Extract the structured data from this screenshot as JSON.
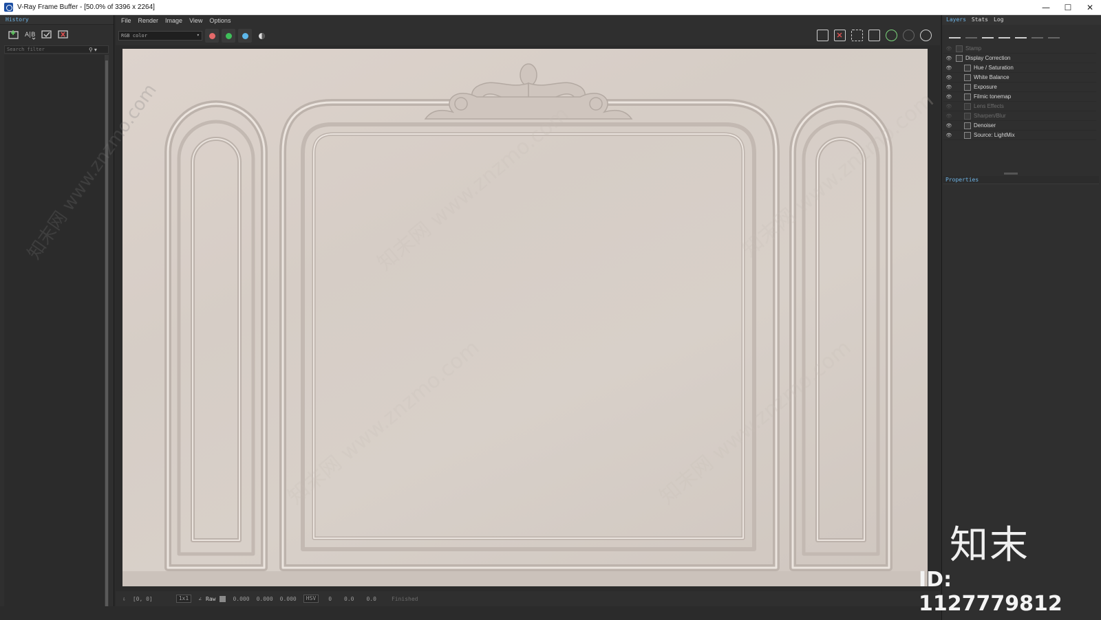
{
  "window": {
    "title": "V-Ray Frame Buffer - [50.0% of 3396 x 2264]",
    "controls": [
      "—",
      "☐",
      "✕"
    ]
  },
  "history": {
    "header": "History",
    "search_placeholder": "Search filter"
  },
  "menu": [
    "File",
    "Render",
    "Image",
    "View",
    "Options"
  ],
  "toolbar": {
    "channel": "RGB color",
    "channel_colors": [
      "#e46a6a",
      "#3fbf5a",
      "#5db7ea"
    ]
  },
  "status": {
    "coords": "[0, 0]",
    "zoom": "1x1",
    "raw_label": "Raw",
    "val1": "0.000",
    "val2": "0.000",
    "val3": "0.000",
    "mode": "HSV",
    "h": "0",
    "s": "0.0",
    "v": "0.0",
    "state": "Finished"
  },
  "right_panel": {
    "tabs": [
      "Layers",
      "Stats",
      "Log"
    ],
    "layers": [
      {
        "label": "Stamp",
        "visible": false,
        "dim": true,
        "level": 0
      },
      {
        "label": "Display Correction",
        "visible": true,
        "dim": false,
        "level": 0
      },
      {
        "label": "Hue / Saturation",
        "visible": true,
        "dim": false,
        "level": 1
      },
      {
        "label": "White Balance",
        "visible": true,
        "dim": false,
        "level": 1
      },
      {
        "label": "Exposure",
        "visible": true,
        "dim": false,
        "level": 1
      },
      {
        "label": "Filmic tonemap",
        "visible": true,
        "dim": false,
        "level": 1
      },
      {
        "label": "Lens Effects",
        "visible": false,
        "dim": true,
        "level": 1
      },
      {
        "label": "Sharpen/Blur",
        "visible": false,
        "dim": true,
        "level": 1
      },
      {
        "label": "Denoiser",
        "visible": true,
        "dim": false,
        "level": 1
      },
      {
        "label": "Source: LightMix",
        "visible": true,
        "dim": false,
        "level": 1
      }
    ],
    "properties_header": "Properties"
  },
  "watermark": {
    "brand": "知末",
    "id": "ID: 1127779812",
    "diag": "知末网 www.znzmo.com"
  }
}
